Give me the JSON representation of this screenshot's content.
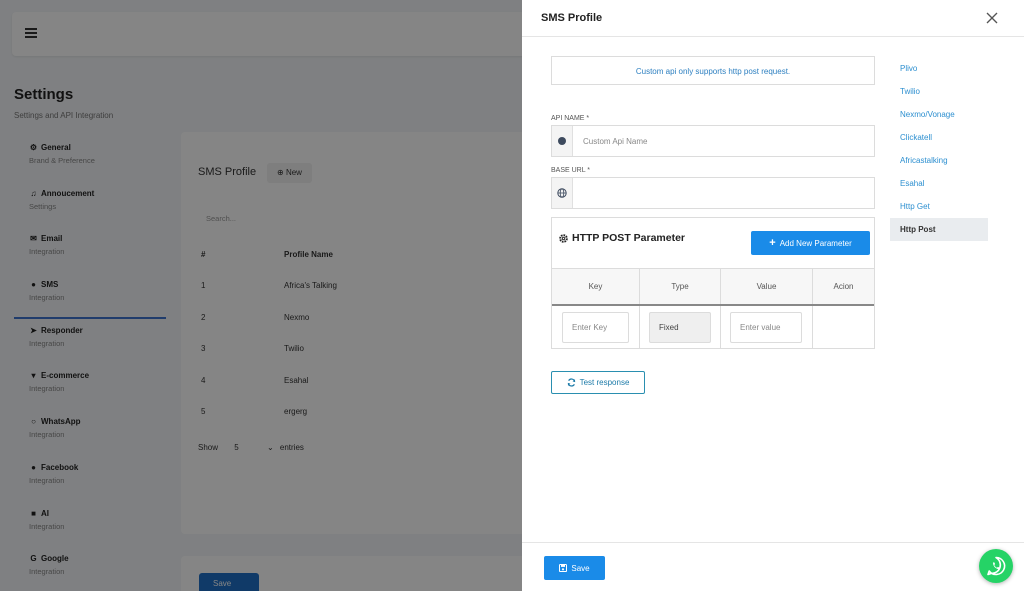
{
  "background": {
    "page_title": "Settings",
    "page_subtitle": "Settings and API Integration",
    "nav": [
      {
        "title": "General",
        "sub": "Brand & Preference",
        "icon": "gear-icon"
      },
      {
        "title": "Annoucement",
        "sub": "Settings",
        "icon": "bell-icon"
      },
      {
        "title": "Email",
        "sub": "Integration",
        "icon": "envelope-icon"
      },
      {
        "title": "SMS",
        "sub": "Integration",
        "icon": "chat-icon"
      },
      {
        "title": "Responder",
        "sub": "Integration",
        "icon": "paper-plane-icon"
      },
      {
        "title": "E-commerce",
        "sub": "Integration",
        "icon": "cart-icon"
      },
      {
        "title": "WhatsApp",
        "sub": "Integration",
        "icon": "whatsapp-icon"
      },
      {
        "title": "Facebook",
        "sub": "Integration",
        "icon": "facebook-icon"
      },
      {
        "title": "AI",
        "sub": "Integration",
        "icon": "robot-icon"
      },
      {
        "title": "Google",
        "sub": "Integration",
        "icon": "google-icon"
      }
    ],
    "card_title": "SMS Profile",
    "new_label": "New",
    "search_placeholder": "Search...",
    "table_headers": [
      "#",
      "Profile Name"
    ],
    "rows": [
      {
        "num": "1",
        "name": "Africa's Talking"
      },
      {
        "num": "2",
        "name": "Nexmo"
      },
      {
        "num": "3",
        "name": "Twilio"
      },
      {
        "num": "4",
        "name": "Esahal"
      },
      {
        "num": "5",
        "name": "ergerg"
      }
    ],
    "show_label": "Show",
    "show_value": "5",
    "entries_label": "entries",
    "save_label": "Save"
  },
  "modal": {
    "title": "SMS Profile",
    "info_text": "Custom api only supports http post request.",
    "api_name_label": "API NAME *",
    "api_name_placeholder": "Custom Api Name",
    "base_url_label": "BASE URL *",
    "base_url_value": "",
    "param_title": "HTTP POST Parameter",
    "add_param_label": "Add New Parameter",
    "param_headers": [
      "Key",
      "Type",
      "Value",
      "Acion"
    ],
    "key_placeholder": "Enter Key",
    "type_value": "Fixed",
    "value_placeholder": "Enter value",
    "test_label": "Test response",
    "save_label": "Save",
    "providers": [
      {
        "label": "Plivo",
        "active": false
      },
      {
        "label": "Twilio",
        "active": false
      },
      {
        "label": "Nexmo/Vonage",
        "active": false
      },
      {
        "label": "Clickatell",
        "active": false
      },
      {
        "label": "Africastalking",
        "active": false
      },
      {
        "label": "Esahal",
        "active": false
      },
      {
        "label": "Http Get",
        "active": false
      },
      {
        "label": "Http Post",
        "active": true
      }
    ]
  },
  "colors": {
    "primary": "#1a8be8",
    "link": "#2c8fd0",
    "whatsapp": "#25d366"
  }
}
